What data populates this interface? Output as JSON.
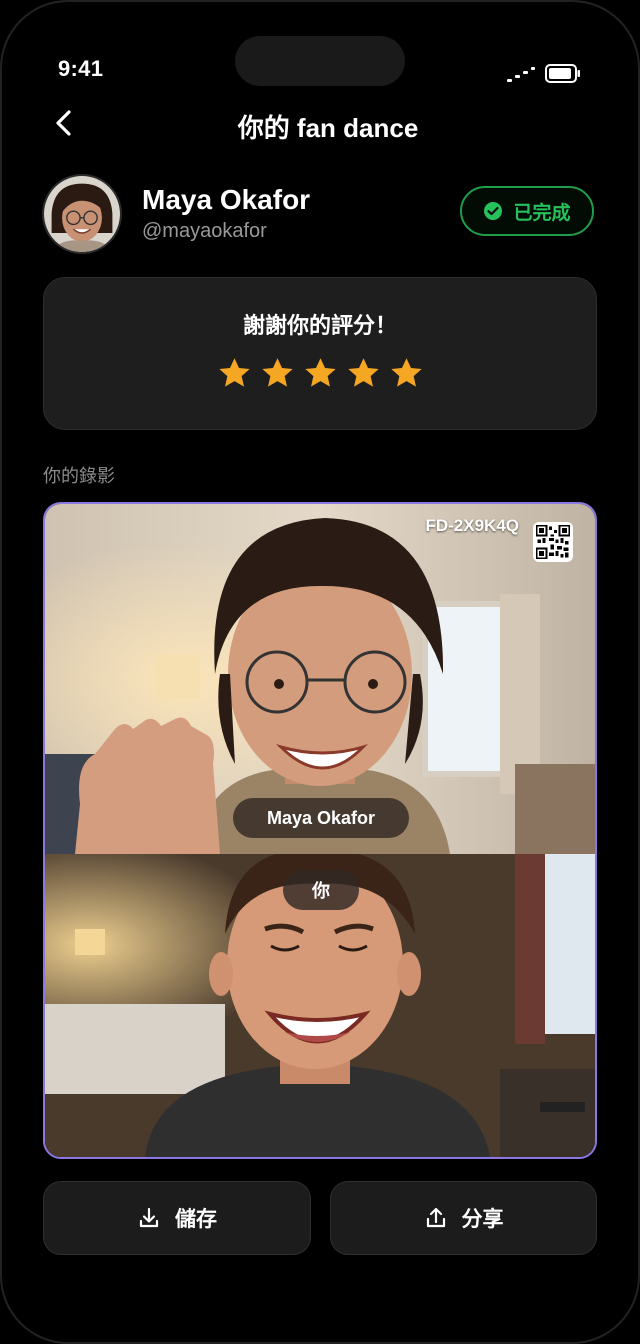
{
  "status": {
    "time": "9:41"
  },
  "nav": {
    "title": "你的 fan dance"
  },
  "profile": {
    "name": "Maya Okafor",
    "handle": "@mayaokafor",
    "badge": "已完成"
  },
  "rating": {
    "message": "謝謝你的評分！",
    "stars": 5,
    "max_stars": 5
  },
  "recording": {
    "section_label": "你的錄影",
    "code": "FD-2X9K4Q",
    "top_label": "Maya Okafor",
    "bottom_label": "你"
  },
  "actions": {
    "save_label": "儲存",
    "share_label": "分享"
  },
  "colors": {
    "accent_purple": "#8a78e0",
    "success_green": "#27c15c",
    "star": "#f5a623",
    "background": "#000000",
    "card": "#1e1e1e"
  }
}
